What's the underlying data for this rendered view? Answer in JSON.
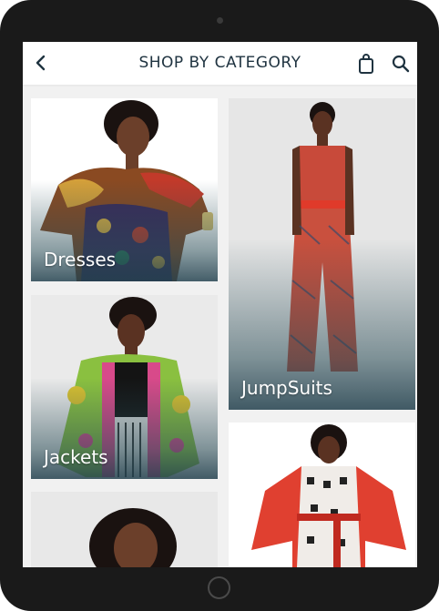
{
  "header": {
    "title": "SHOP BY CATEGORY",
    "back_icon": "chevron-left-icon",
    "bag_icon": "shopping-bag-icon",
    "search_icon": "search-icon"
  },
  "categories": [
    {
      "label": "Dresses"
    },
    {
      "label": "JumpSuits"
    },
    {
      "label": "Jackets"
    },
    {
      "label": ""
    },
    {
      "label": ""
    }
  ],
  "colors": {
    "title": "#1f3340",
    "screen_bg": "#f1f1f1",
    "device_bezel": "#1a1a1a",
    "label_text": "#ffffff"
  }
}
